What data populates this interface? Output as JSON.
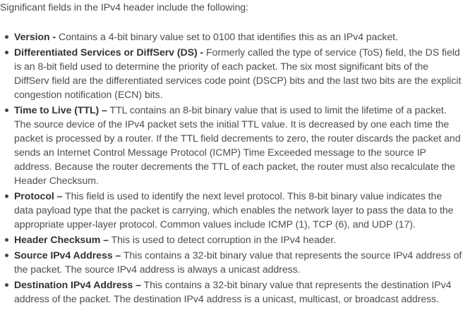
{
  "intro": "Significant fields in the IPv4 header include the following:",
  "fields": [
    {
      "term": "Version -",
      "description": "Contains a 4-bit binary value set to 0100 that identifies this as an IPv4 packet."
    },
    {
      "term": "Differentiated Services or DiffServ (DS) -",
      "description": "Formerly called the type of service (ToS) field, the DS field is an 8-bit field used to determine the priority of each packet. The six most significant bits of the DiffServ field are the differentiated services code point (DSCP) bits and the last two bits are the explicit congestion notification (ECN) bits."
    },
    {
      "term": "Time to Live (TTL) –",
      "description": "TTL contains an 8-bit binary value that is used to limit the lifetime of a packet. The source device of the IPv4 packet sets the initial TTL value. It is decreased by one each time the packet is processed by a router. If the TTL field decrements to zero, the router discards the packet and sends an Internet Control Message Protocol (ICMP) Time Exceeded message to the source IP address. Because the router decrements the TTL of each packet, the router must also recalculate the Header Checksum."
    },
    {
      "term": "Protocol –",
      "description": "This field is used to identify the next level protocol. This 8-bit binary value indicates the data payload type that the packet is carrying, which enables the network layer to pass the data to the appropriate upper-layer protocol. Common values include ICMP (1), TCP (6), and UDP (17)."
    },
    {
      "term": "Header Checksum –",
      "description": "This is used to detect corruption in the IPv4 header."
    },
    {
      "term": "Source IPv4 Address –",
      "description": "This contains a 32-bit binary value that represents the source IPv4 address of the packet. The source IPv4 address is always a unicast address."
    },
    {
      "term": "Destination IPv4 Address –",
      "description": "This contains a 32-bit binary value that represents the destination IPv4 address of the packet. The destination IPv4 address is a unicast, multicast, or broadcast address."
    }
  ]
}
